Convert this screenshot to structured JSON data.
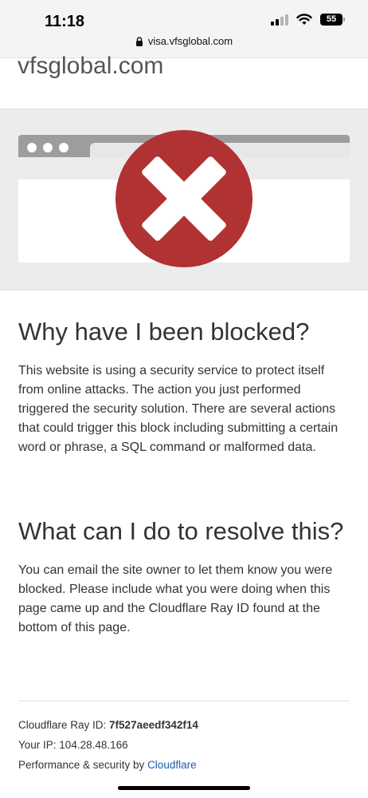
{
  "status_bar": {
    "time": "11:18",
    "battery": "55"
  },
  "address_bar": {
    "url": "visa.vfsglobal.com"
  },
  "page": {
    "site_title": "vfsglobal.com",
    "heading_blocked": "Why have I been blocked?",
    "blocked_text": "This website is using a security service to protect itself from online attacks. The action you just performed triggered the security solution. There are several actions that could trigger this block including submitting a certain word or phrase, a SQL command or malformed data.",
    "heading_resolve": "What can I do to resolve this?",
    "resolve_text": "You can email the site owner to let them know you were blocked. Please include what you were doing when this page came up and the Cloudflare Ray ID found at the bottom of this page."
  },
  "footer": {
    "ray_label": "Cloudflare Ray ID: ",
    "ray_value": "7f527aeedf342f14",
    "ip_label": "Your IP: ",
    "ip_value": "104.28.48.166",
    "perf_label": "Performance & security by ",
    "perf_link": "Cloudflare"
  },
  "icons": [
    "lock-icon",
    "cellular-signal-icon",
    "wifi-icon",
    "battery-icon",
    "error-x-icon"
  ],
  "colors": {
    "error_red": "#b03232",
    "link_blue": "#1f5ea8"
  }
}
